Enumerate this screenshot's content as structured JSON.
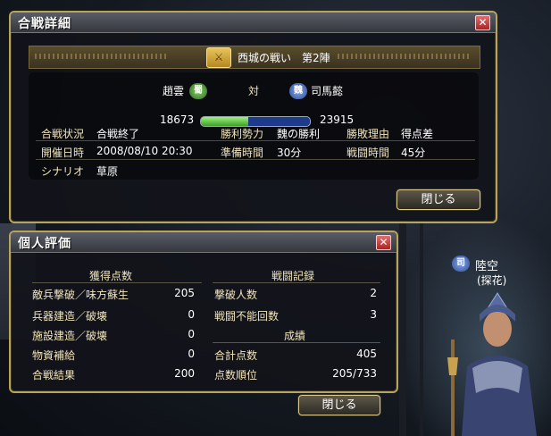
{
  "battle_window": {
    "title": "合戦詳細",
    "battle_name": "西城の戦い　第2陣",
    "side_a": {
      "general": "趙雲",
      "faction": "蜀",
      "score": "18673"
    },
    "versus": "対",
    "side_b": {
      "general": "司馬懿",
      "faction": "魏",
      "score": "23915"
    },
    "score_ratio": 0.438,
    "status_label": "合戦状況",
    "status_value": "合戦終了",
    "winner_label": "勝利勢力",
    "winner_value": "魏の勝利",
    "reason_label": "勝敗理由",
    "reason_value": "得点差",
    "date_label": "開催日時",
    "date_value": "2008/08/10 20:30",
    "prep_label": "準備時間",
    "prep_value": "30分",
    "battle_time_label": "戦闘時間",
    "battle_time_value": "45分",
    "scenario_label": "シナリオ",
    "scenario_value": "草原",
    "close_label": "閉じる"
  },
  "personal_window": {
    "title": "個人評価",
    "points_header": "獲得点数",
    "record_header": "戦闘記録",
    "result_header": "成績",
    "points": [
      {
        "label": "敵兵撃破／味方蘇生",
        "value": "205"
      },
      {
        "label": "兵器建造／破壊",
        "value": "0"
      },
      {
        "label": "施設建造／破壊",
        "value": "0"
      },
      {
        "label": "物資補給",
        "value": "0"
      },
      {
        "label": "合戦結果",
        "value": "200"
      }
    ],
    "record": [
      {
        "label": "撃破人数",
        "value": "2"
      },
      {
        "label": "戦闘不能回数",
        "value": "3"
      }
    ],
    "result": [
      {
        "label": "合計点数",
        "value": "405"
      },
      {
        "label": "点数順位",
        "value": "205/733"
      }
    ],
    "close_label": "閉じる"
  },
  "character": {
    "name": "陸空",
    "sub": "(探花)",
    "faction": "司"
  }
}
